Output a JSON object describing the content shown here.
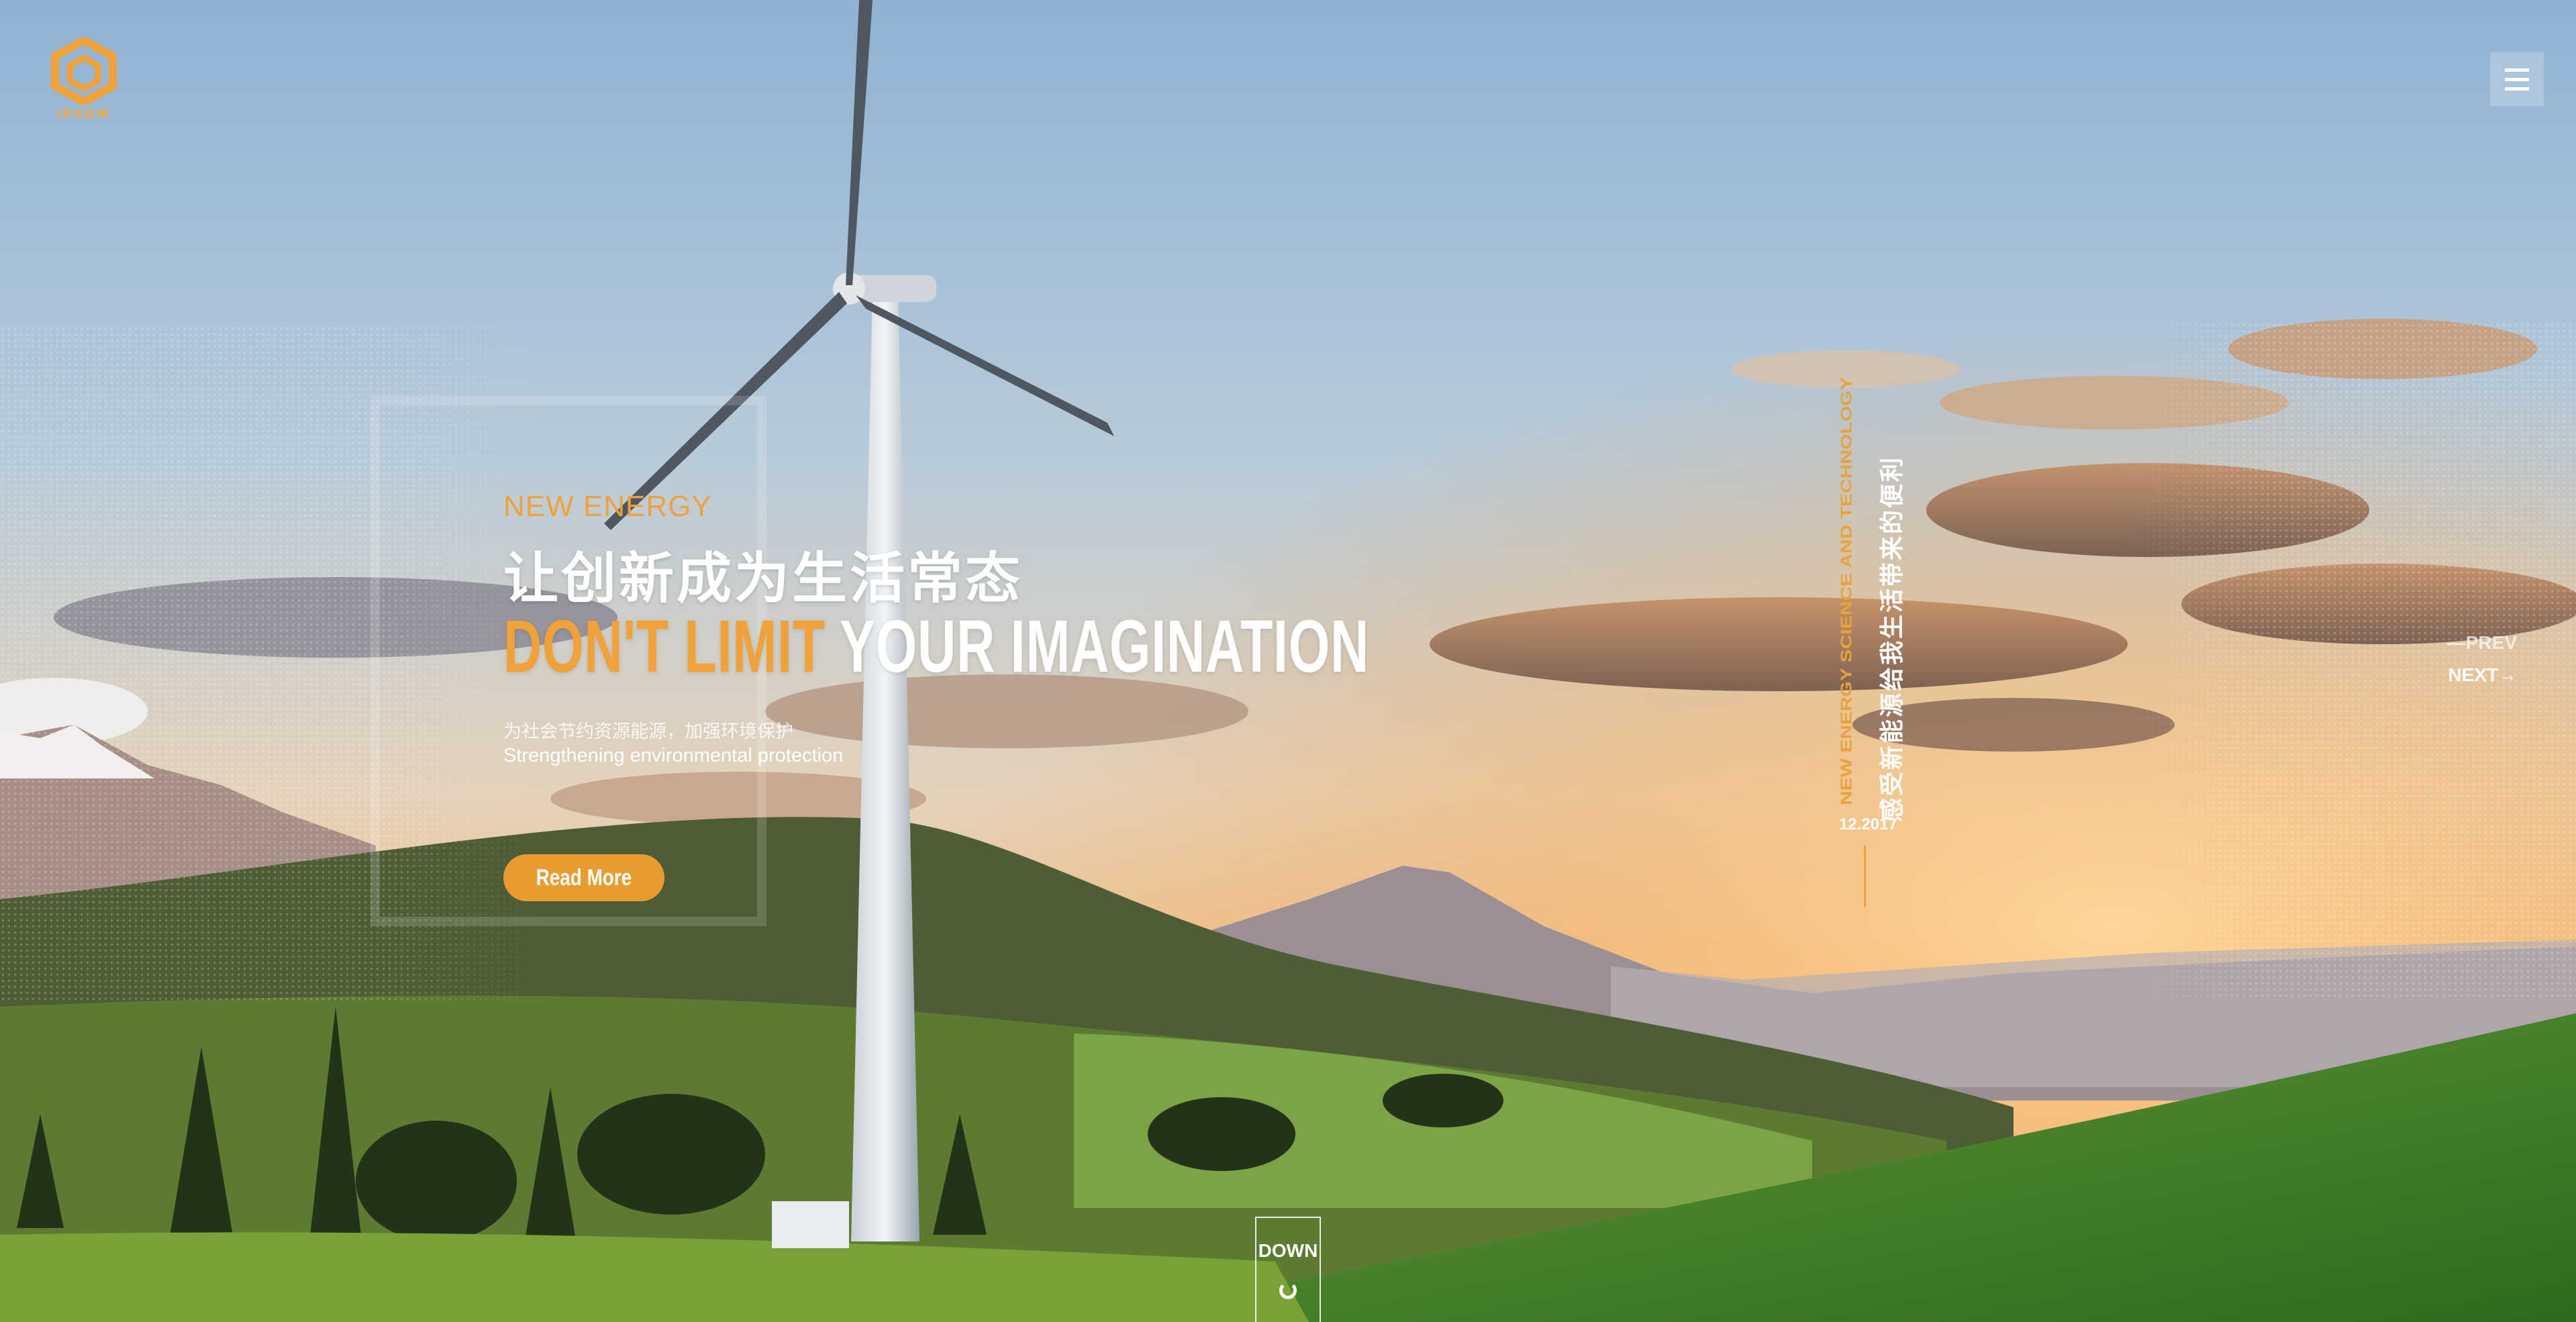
{
  "brand": {
    "logo_text": "IPSUM",
    "accent_color": "#f0a139"
  },
  "hero": {
    "eyebrow": "NEW ENERGY",
    "headline_cn": "让创新成为生活常态",
    "headline_accent": "DON'T LIMIT",
    "headline_rest": "YOUR IMAGINATION",
    "subtitle_cn": "为社会节约资源能源，加强环境保护",
    "subtitle_en": "Strengthening environmental protection",
    "cta_label": "Read More"
  },
  "side_caption": {
    "en": "NEW ENERGY SCIENCE AND TECHNOLOGY",
    "cn": "感受新能源给我生活带来的便利",
    "date": "12.2017"
  },
  "slider_nav": {
    "prev_label": "PREV",
    "next_label": "NEXT"
  },
  "scroll": {
    "down_label": "DOWN"
  },
  "icons": {
    "logo": "hexagon-logo-icon",
    "menu": "hamburger-menu-icon",
    "prev": "dash-icon",
    "next": "arrow-right-icon",
    "down": "circle-loader-icon"
  }
}
